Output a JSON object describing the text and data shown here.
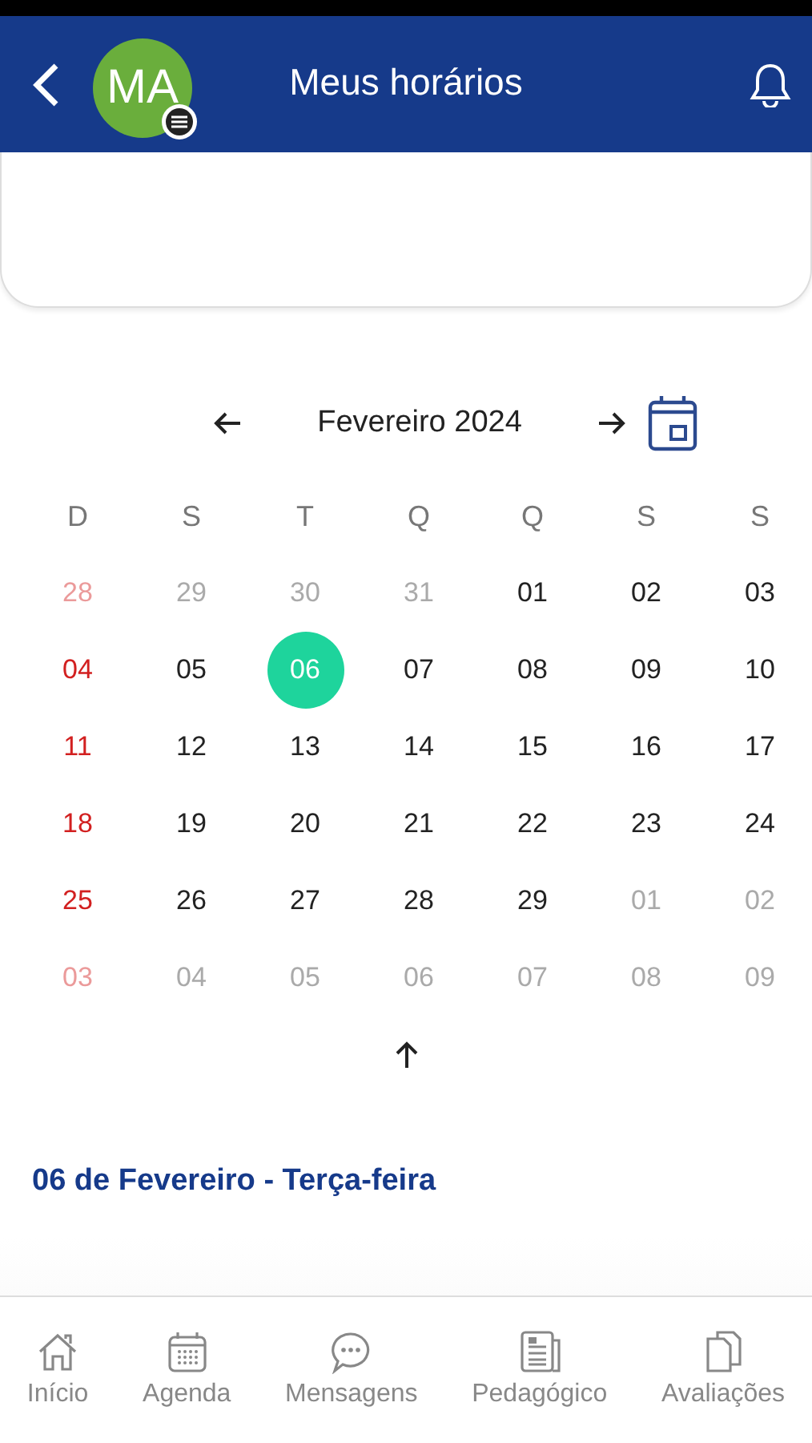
{
  "header": {
    "avatar_initials": "MA",
    "title": "Meus horários"
  },
  "calendar": {
    "month": "Fevereiro 2024",
    "weekdays": [
      "D",
      "S",
      "T",
      "Q",
      "Q",
      "S",
      "S"
    ],
    "weeks": [
      [
        {
          "day": "28",
          "kind": "other",
          "selected": false
        },
        {
          "day": "29",
          "kind": "other",
          "selected": false
        },
        {
          "day": "30",
          "kind": "other",
          "selected": false
        },
        {
          "day": "31",
          "kind": "other",
          "selected": false
        },
        {
          "day": "01",
          "kind": "current",
          "selected": false
        },
        {
          "day": "02",
          "kind": "current",
          "selected": false
        },
        {
          "day": "03",
          "kind": "current",
          "selected": false
        }
      ],
      [
        {
          "day": "04",
          "kind": "current",
          "selected": false
        },
        {
          "day": "05",
          "kind": "current",
          "selected": false
        },
        {
          "day": "06",
          "kind": "current",
          "selected": true
        },
        {
          "day": "07",
          "kind": "current",
          "selected": false
        },
        {
          "day": "08",
          "kind": "current",
          "selected": false
        },
        {
          "day": "09",
          "kind": "current",
          "selected": false
        },
        {
          "day": "10",
          "kind": "current",
          "selected": false
        }
      ],
      [
        {
          "day": "11",
          "kind": "current",
          "selected": false
        },
        {
          "day": "12",
          "kind": "current",
          "selected": false
        },
        {
          "day": "13",
          "kind": "current",
          "selected": false
        },
        {
          "day": "14",
          "kind": "current",
          "selected": false
        },
        {
          "day": "15",
          "kind": "current",
          "selected": false
        },
        {
          "day": "16",
          "kind": "current",
          "selected": false
        },
        {
          "day": "17",
          "kind": "current",
          "selected": false
        }
      ],
      [
        {
          "day": "18",
          "kind": "current",
          "selected": false
        },
        {
          "day": "19",
          "kind": "current",
          "selected": false
        },
        {
          "day": "20",
          "kind": "current",
          "selected": false
        },
        {
          "day": "21",
          "kind": "current",
          "selected": false
        },
        {
          "day": "22",
          "kind": "current",
          "selected": false
        },
        {
          "day": "23",
          "kind": "current",
          "selected": false
        },
        {
          "day": "24",
          "kind": "current",
          "selected": false
        }
      ],
      [
        {
          "day": "25",
          "kind": "current",
          "selected": false
        },
        {
          "day": "26",
          "kind": "current",
          "selected": false
        },
        {
          "day": "27",
          "kind": "current",
          "selected": false
        },
        {
          "day": "28",
          "kind": "current",
          "selected": false
        },
        {
          "day": "29",
          "kind": "current",
          "selected": false
        },
        {
          "day": "01",
          "kind": "other",
          "selected": false
        },
        {
          "day": "02",
          "kind": "other",
          "selected": false
        }
      ],
      [
        {
          "day": "03",
          "kind": "other",
          "selected": false
        },
        {
          "day": "04",
          "kind": "other",
          "selected": false
        },
        {
          "day": "05",
          "kind": "other",
          "selected": false
        },
        {
          "day": "06",
          "kind": "other",
          "selected": false
        },
        {
          "day": "07",
          "kind": "other",
          "selected": false
        },
        {
          "day": "08",
          "kind": "other",
          "selected": false
        },
        {
          "day": "09",
          "kind": "other",
          "selected": false
        }
      ]
    ]
  },
  "selected_date": "06 de Fevereiro - Terça-feira",
  "nav": [
    {
      "label": "Início",
      "kind": "home"
    },
    {
      "label": "Agenda",
      "kind": "calendar"
    },
    {
      "label": "Mensagens",
      "kind": "chat"
    },
    {
      "label": "Pedagógico",
      "kind": "news"
    },
    {
      "label": "Avaliações",
      "kind": "docs"
    }
  ]
}
